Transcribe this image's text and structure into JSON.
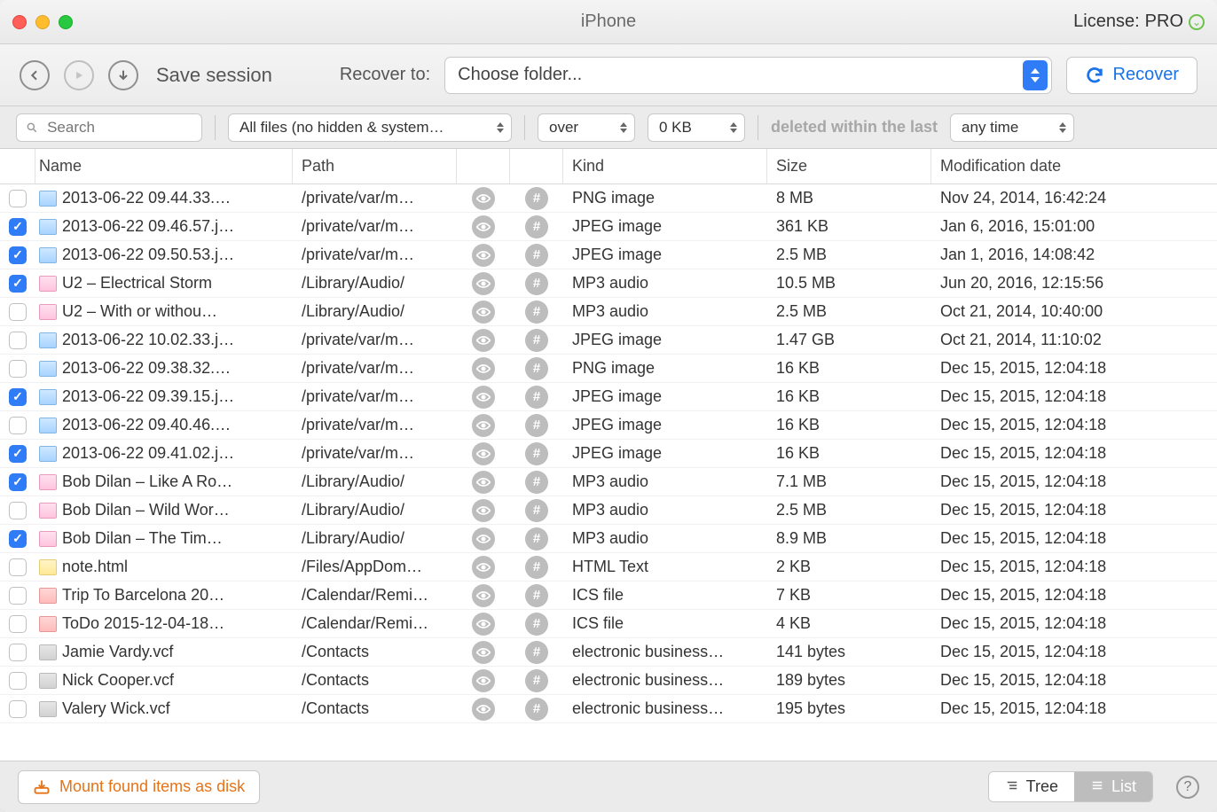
{
  "window": {
    "title": "iPhone"
  },
  "license": {
    "label": "License:",
    "level": "PRO"
  },
  "toolbar": {
    "save_session": "Save session",
    "recover_to_label": "Recover to:",
    "folder_placeholder": "Choose folder...",
    "recover_button": "Recover"
  },
  "filters": {
    "search_placeholder": "Search",
    "file_filter": "All files (no hidden & system…",
    "size_op": "over",
    "size_value": "0 KB",
    "deleted_label": "deleted within the last",
    "deleted_value": "any time"
  },
  "columns": {
    "name": "Name",
    "path": "Path",
    "kind": "Kind",
    "size": "Size",
    "date": "Modification date"
  },
  "rows": [
    {
      "checked": false,
      "icon": "img",
      "name": "2013-06-22 09.44.33.…",
      "path": "/private/var/m…",
      "kind": "PNG image",
      "size": "8 MB",
      "date": "Nov 24, 2014, 16:42:24"
    },
    {
      "checked": true,
      "icon": "img",
      "name": "2013-06-22 09.46.57.j…",
      "path": "/private/var/m…",
      "kind": "JPEG image",
      "size": "361 KB",
      "date": "Jan 6, 2016, 15:01:00"
    },
    {
      "checked": true,
      "icon": "img",
      "name": "2013-06-22 09.50.53.j…",
      "path": "/private/var/m…",
      "kind": "JPEG image",
      "size": "2.5 MB",
      "date": "Jan 1, 2016, 14:08:42"
    },
    {
      "checked": true,
      "icon": "audio",
      "name": "U2 – Electrical Storm",
      "path": "/Library/Audio/",
      "kind": "MP3 audio",
      "size": "10.5 MB",
      "date": "Jun 20, 2016, 12:15:56"
    },
    {
      "checked": false,
      "icon": "audio",
      "name": "U2 – With or withou…",
      "path": "/Library/Audio/",
      "kind": "MP3 audio",
      "size": "2.5 MB",
      "date": "Oct 21, 2014, 10:40:00"
    },
    {
      "checked": false,
      "icon": "img",
      "name": "2013-06-22 10.02.33.j…",
      "path": "/private/var/m…",
      "kind": "JPEG image",
      "size": "1.47 GB",
      "date": "Oct 21, 2014, 11:10:02"
    },
    {
      "checked": false,
      "icon": "img",
      "name": "2013-06-22 09.38.32.…",
      "path": "/private/var/m…",
      "kind": "PNG image",
      "size": "16 KB",
      "date": "Dec 15, 2015, 12:04:18"
    },
    {
      "checked": true,
      "icon": "img",
      "name": "2013-06-22 09.39.15.j…",
      "path": "/private/var/m…",
      "kind": "JPEG image",
      "size": "16 KB",
      "date": "Dec 15, 2015, 12:04:18"
    },
    {
      "checked": false,
      "icon": "img",
      "name": "2013-06-22 09.40.46.…",
      "path": "/private/var/m…",
      "kind": "JPEG image",
      "size": "16 KB",
      "date": "Dec 15, 2015, 12:04:18"
    },
    {
      "checked": true,
      "icon": "img",
      "name": "2013-06-22 09.41.02.j…",
      "path": "/private/var/m…",
      "kind": "JPEG image",
      "size": "16 KB",
      "date": "Dec 15, 2015, 12:04:18"
    },
    {
      "checked": true,
      "icon": "audio",
      "name": "Bob Dilan – Like A Ro…",
      "path": "/Library/Audio/",
      "kind": "MP3 audio",
      "size": "7.1 MB",
      "date": "Dec 15, 2015, 12:04:18"
    },
    {
      "checked": false,
      "icon": "audio",
      "name": "Bob Dilan – Wild Wor…",
      "path": "/Library/Audio/",
      "kind": "MP3 audio",
      "size": "2.5 MB",
      "date": "Dec 15, 2015, 12:04:18"
    },
    {
      "checked": true,
      "icon": "audio",
      "name": "Bob Dilan – The Tim…",
      "path": "/Library/Audio/",
      "kind": "MP3 audio",
      "size": "8.9 MB",
      "date": "Dec 15, 2015, 12:04:18"
    },
    {
      "checked": false,
      "icon": "html",
      "name": "note.html",
      "path": "/Files/AppDom…",
      "kind": "HTML Text",
      "size": "2 KB",
      "date": "Dec 15, 2015, 12:04:18"
    },
    {
      "checked": false,
      "icon": "cal",
      "name": "Trip To Barcelona 20…",
      "path": "/Calendar/Remi…",
      "kind": "ICS file",
      "size": "7 KB",
      "date": "Dec 15, 2015, 12:04:18"
    },
    {
      "checked": false,
      "icon": "cal",
      "name": "ToDo 2015-12-04-18…",
      "path": "/Calendar/Remi…",
      "kind": "ICS file",
      "size": "4 KB",
      "date": "Dec 15, 2015, 12:04:18"
    },
    {
      "checked": false,
      "icon": "vcf",
      "name": "Jamie Vardy.vcf",
      "path": "/Contacts",
      "kind": "electronic business…",
      "size": "141 bytes",
      "date": "Dec 15, 2015, 12:04:18"
    },
    {
      "checked": false,
      "icon": "vcf",
      "name": "Nick Cooper.vcf",
      "path": "/Contacts",
      "kind": "electronic business…",
      "size": "189 bytes",
      "date": "Dec 15, 2015, 12:04:18"
    },
    {
      "checked": false,
      "icon": "vcf",
      "name": "Valery Wick.vcf",
      "path": "/Contacts",
      "kind": "electronic business…",
      "size": "195 bytes",
      "date": "Dec 15, 2015, 12:04:18"
    }
  ],
  "statusbar": {
    "mount_label": "Mount found items as disk",
    "tree_label": "Tree",
    "list_label": "List"
  }
}
